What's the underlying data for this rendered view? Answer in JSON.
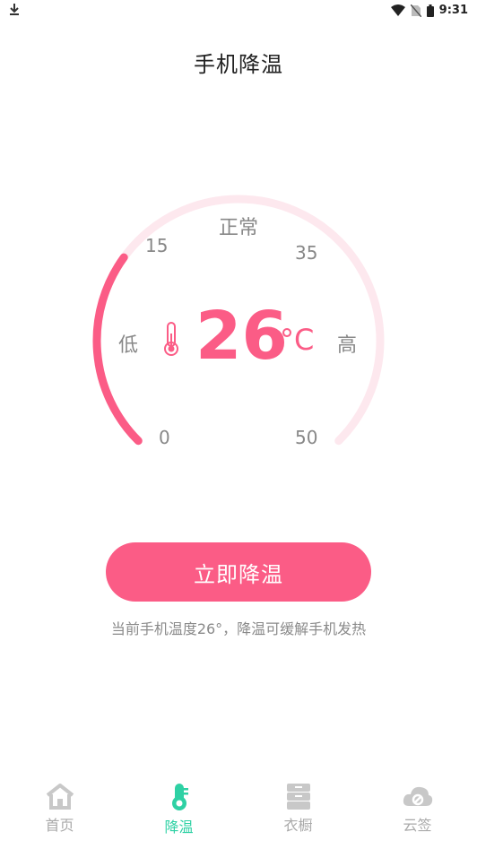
{
  "status_bar": {
    "time": "9:31"
  },
  "header": {
    "title": "手机降温"
  },
  "gauge": {
    "status_label": "正常",
    "tick_low": "15",
    "tick_high": "35",
    "tick_min": "0",
    "tick_max": "50",
    "side_low": "低",
    "side_high": "高",
    "min": 0,
    "max": 50,
    "current": 26,
    "arc_fill_fraction": 0.3,
    "track_color": "#fde8ee",
    "fill_color": "#fb5c86"
  },
  "temperature": {
    "value": "26",
    "unit": "°C",
    "icon": "thermometer-icon"
  },
  "action": {
    "button_label": "立即降温"
  },
  "hint": {
    "text": "当前手机温度26°，降温可缓解手机发热"
  },
  "tabs": [
    {
      "label": "首页",
      "icon": "home-icon",
      "active": false
    },
    {
      "label": "降温",
      "icon": "thermometer-icon",
      "active": true
    },
    {
      "label": "衣橱",
      "icon": "wardrobe-icon",
      "active": false
    },
    {
      "label": "云签",
      "icon": "cloud-sign-icon",
      "active": false
    }
  ],
  "colors": {
    "accent": "#fb5c86",
    "tab_active": "#2ed1a4",
    "tab_inactive": "#c8c8c8"
  }
}
